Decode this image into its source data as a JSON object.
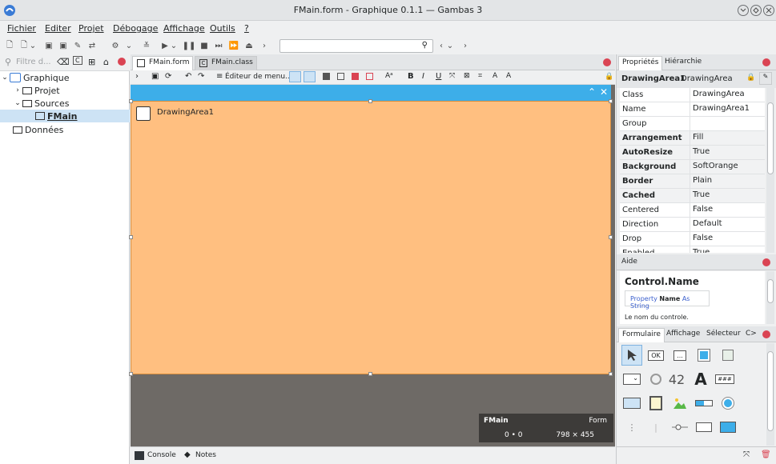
{
  "window": {
    "title": "FMain.form - Graphique 0.1.1 — Gambas 3"
  },
  "menu": [
    "Fichier",
    "Editer",
    "Projet",
    "Débogage",
    "Affichage",
    "Outils",
    "?"
  ],
  "search": {
    "placeholder": ""
  },
  "filter": {
    "placeholder": "Filtre d..."
  },
  "tree": {
    "root": "Graphique",
    "projet": "Projet",
    "sources": "Sources",
    "fmain": "FMain",
    "donnees": "Données"
  },
  "editor_tabs": [
    "FMain.form",
    "FMain.class"
  ],
  "form_toolbar": {
    "menu_editor": "Éditeur de menu..."
  },
  "form": {
    "control_label": "DrawingArea1"
  },
  "info": {
    "name": "FMain",
    "kind": "Form",
    "position": "0 • 0",
    "size": "798 × 455"
  },
  "bottom": {
    "console": "Console",
    "notes": "Notes"
  },
  "properties": {
    "tabs": [
      "Propriétés",
      "Hiérarchie"
    ],
    "header_name": "DrawingArea1",
    "header_class": "DrawingArea",
    "rows": [
      {
        "name": "Class",
        "value": "DrawingArea"
      },
      {
        "name": "Name",
        "value": "DrawingArea1"
      },
      {
        "name": "Group",
        "value": ""
      },
      {
        "name": "Arrangement",
        "value": "Fill"
      },
      {
        "name": "AutoResize",
        "value": "True"
      },
      {
        "name": "Background",
        "value": "SoftOrange"
      },
      {
        "name": "Border",
        "value": "Plain"
      },
      {
        "name": "Cached",
        "value": "True"
      },
      {
        "name": "Centered",
        "value": "False"
      },
      {
        "name": "Direction",
        "value": "Default"
      },
      {
        "name": "Drop",
        "value": "False"
      },
      {
        "name": "Enabled",
        "value": "True"
      }
    ]
  },
  "help": {
    "tab": "Aide",
    "title": "Control.Name",
    "sig_prop": "Property",
    "sig_name": "Name",
    "sig_as": "As",
    "sig_type": "String",
    "desc": "Le nom du controle."
  },
  "toolbox": {
    "tabs": [
      "Formulaire",
      "Affichage",
      "Sélecteur",
      "C>"
    ],
    "ok_label": "OK",
    "dots_label": "...",
    "num_label": "42",
    "a_label": "A",
    "pwd_label": "###"
  },
  "colors": {
    "accent": "#3daee9",
    "form_bg": "#ffbf80",
    "close_red": "#da4453"
  }
}
